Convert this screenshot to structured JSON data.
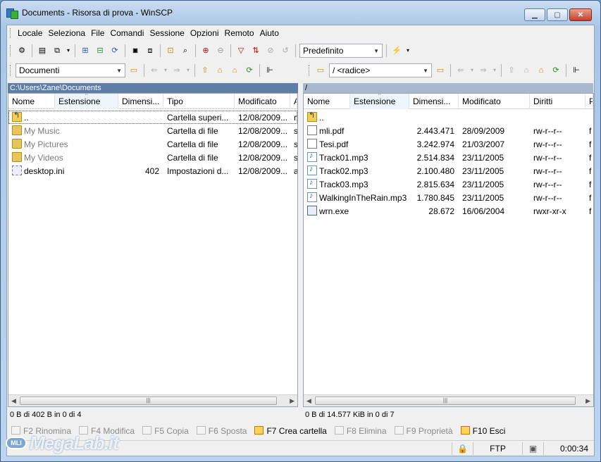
{
  "window": {
    "title": "Documents - Risorsa di prova - WinSCP"
  },
  "menu": [
    "Locale",
    "Seleziona",
    "File",
    "Comandi",
    "Sessione",
    "Opzioni",
    "Remoto",
    "Aiuto"
  ],
  "toolbar": {
    "transfer_profile": "Predefinito"
  },
  "left": {
    "location": "Documenti",
    "path": "C:\\Users\\Zane\\Documents",
    "columns": [
      "Nome",
      "Estensione",
      "Dimensi...",
      "Tipo",
      "Modificato",
      "A"
    ],
    "rows": [
      {
        "name": "..",
        "size": "",
        "type": "Cartella superi...",
        "modified": "12/08/2009...",
        "attr": "r",
        "icon": "up-folder-icon"
      },
      {
        "name": "My Music",
        "size": "",
        "type": "Cartella di file",
        "modified": "12/08/2009...",
        "attr": "s",
        "icon": "music-folder-icon"
      },
      {
        "name": "My Pictures",
        "size": "",
        "type": "Cartella di file",
        "modified": "12/08/2009...",
        "attr": "s",
        "icon": "pictures-folder-icon"
      },
      {
        "name": "My Videos",
        "size": "",
        "type": "Cartella di file",
        "modified": "12/08/2009...",
        "attr": "s",
        "icon": "videos-folder-icon"
      },
      {
        "name": "desktop.ini",
        "size": "402",
        "type": "Impostazioni d...",
        "modified": "12/08/2009...",
        "attr": "a",
        "icon": "settings-file-icon"
      }
    ],
    "status": "0 B di 402 B in 0 di 4"
  },
  "right": {
    "location": "/ <radice>",
    "path": "/",
    "columns": [
      "Nome",
      "Estensione",
      "Dimensi...",
      "Modificato",
      "Diritti",
      "P"
    ],
    "rows": [
      {
        "name": "..",
        "size": "",
        "modified": "",
        "rights": "",
        "owner": "",
        "icon": "up-folder-icon"
      },
      {
        "name": "mli.pdf",
        "size": "2.443.471",
        "modified": "28/09/2009",
        "rights": "rw-r--r--",
        "owner": "f",
        "icon": "file-icon"
      },
      {
        "name": "Tesi.pdf",
        "size": "3.242.974",
        "modified": "21/03/2007",
        "rights": "rw-r--r--",
        "owner": "f",
        "icon": "file-icon"
      },
      {
        "name": "Track01.mp3",
        "size": "2.514.834",
        "modified": "23/11/2005",
        "rights": "rw-r--r--",
        "owner": "f",
        "icon": "audio-file-icon"
      },
      {
        "name": "Track02.mp3",
        "size": "2.100.480",
        "modified": "23/11/2005",
        "rights": "rw-r--r--",
        "owner": "f",
        "icon": "audio-file-icon"
      },
      {
        "name": "Track03.mp3",
        "size": "2.815.634",
        "modified": "23/11/2005",
        "rights": "rw-r--r--",
        "owner": "f",
        "icon": "audio-file-icon"
      },
      {
        "name": "WalkingInTheRain.mp3",
        "size": "1.780.845",
        "modified": "23/11/2005",
        "rights": "rw-r--r--",
        "owner": "f",
        "icon": "audio-file-icon"
      },
      {
        "name": "wrn.exe",
        "size": "28.672",
        "modified": "16/06/2004",
        "rights": "rwxr-xr-x",
        "owner": "f",
        "icon": "executable-file-icon"
      }
    ],
    "status": "0 B di 14.577 KiB in 0 di 7"
  },
  "fkeys": [
    {
      "label": "F2 Rinomina",
      "enabled": false
    },
    {
      "label": "F4 Modifica",
      "enabled": false
    },
    {
      "label": "F5 Copia",
      "enabled": false
    },
    {
      "label": "F6 Sposta",
      "enabled": false
    },
    {
      "label": "F7 Crea cartella",
      "enabled": true
    },
    {
      "label": "F8 Elimina",
      "enabled": false
    },
    {
      "label": "F9 Proprietà",
      "enabled": false
    },
    {
      "label": "F10 Esci",
      "enabled": true
    }
  ],
  "statusbar": {
    "protocol": "FTP",
    "elapsed": "0:00:34"
  },
  "watermark": {
    "badge": "MLI",
    "text": "MegaLab.it"
  },
  "colors": {
    "active_path": "#5e7ea8",
    "inactive_path": "#a8b9cf",
    "disabled_text": "#8a8a8a"
  }
}
